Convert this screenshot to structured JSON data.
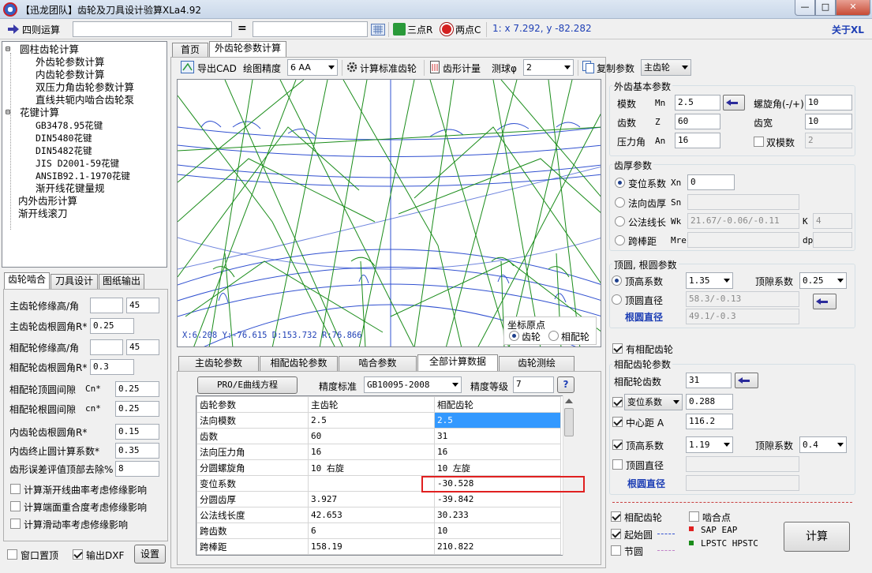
{
  "window": {
    "title": "【迅龙团队】齿轮及刀具设计验算XLa4.92",
    "min": "—",
    "max": "□",
    "close": "✕"
  },
  "calcbar": {
    "label": "四则运算",
    "equals": "=",
    "three_point": "三点R",
    "two_point": "两点C",
    "coords": "1: x 7.292, y -82.282",
    "about": "关于XL"
  },
  "tree": {
    "items": [
      {
        "label": "圆柱齿轮计算",
        "level": 0
      },
      {
        "label": "外齿轮参数计算",
        "level": 2
      },
      {
        "label": "内齿轮参数计算",
        "level": 2
      },
      {
        "label": "双压力角齿轮参数计算",
        "level": 2
      },
      {
        "label": "直线共轭内啮合齿轮泵",
        "level": 2
      },
      {
        "label": "花键计算",
        "level": 0
      },
      {
        "label": "GB3478.95花键",
        "level": 2
      },
      {
        "label": "DIN5480花键",
        "level": 2
      },
      {
        "label": "DIN5482花键",
        "level": 2
      },
      {
        "label": "JIS D2001-59花键",
        "level": 2
      },
      {
        "label": "ANSIB92.1-1970花键",
        "level": 2
      },
      {
        "label": "渐开线花键量规",
        "level": 2
      },
      {
        "label": "内外齿形计算",
        "level": 1
      },
      {
        "label": "渐开线滚刀",
        "level": 1
      }
    ]
  },
  "left_tabs": [
    "齿轮啮合",
    "刀具设计",
    "图纸输出"
  ],
  "mesh": {
    "fields": [
      {
        "label": "主齿轮修缘高/角",
        "v1": "",
        "v2": "45"
      },
      {
        "label": "主齿轮齿根圆角R*",
        "v1": "0.25"
      },
      {
        "label": "相配轮修缘高/角",
        "v1": "",
        "v2": "45"
      },
      {
        "label": "相配轮齿根圆角R*",
        "v1": "0.3"
      },
      {
        "label": "相配轮顶圆间隙",
        "sub": "Cn*",
        "v1": "0.25"
      },
      {
        "label": "相配轮根圆间隙",
        "sub": "cn*",
        "v1": "0.25"
      },
      {
        "label": "内齿轮齿根圆角R*",
        "v1": "0.15"
      },
      {
        "label": "内齿终止圆计算系数*",
        "v1": "0.35"
      },
      {
        "label": "齿形误差评值顶部去除%",
        "v1": "8"
      }
    ],
    "checks": [
      "计算渐开线曲率考虑修缘影响",
      "计算端面重合度考虑修缘影响",
      "计算滑动率考虑修缘影响"
    ],
    "bottom": {
      "topmost": "窗口置顶",
      "dxf": "输出DXF",
      "settings": "设置"
    }
  },
  "main_tabs": [
    "首页",
    "外齿轮参数计算"
  ],
  "toolbar": {
    "export": "导出CAD",
    "precision_label": "绘图精度",
    "precision": "6  AA",
    "calc_std": "计算标准齿轮",
    "tooth_measure": "齿形计量",
    "ball_label": "测球φ",
    "ball": "2",
    "copy": "复制参数",
    "gear_sel": "主齿轮"
  },
  "canvas": {
    "status": "X:6.208    Y:-76.615  D:153.732  R:76.866",
    "origin_title": "坐标原点",
    "origin_gear": "齿轮",
    "origin_mate": "相配轮"
  },
  "bottom_tabs": [
    "主齿轮参数",
    "相配齿轮参数",
    "啮合参数",
    "全部计算数据",
    "齿轮测绘"
  ],
  "data_panel": {
    "pro_btn": "PRO/E曲线方程",
    "std_label": "精度标准",
    "std": "GB10095-2008",
    "grade_label": "精度等级",
    "grade": "7",
    "help": "?"
  },
  "table": {
    "rows": [
      [
        "齿轮参数",
        "主齿轮",
        "相配齿轮"
      ],
      [
        "法向模数",
        "2.5",
        "2.5"
      ],
      [
        "齿数",
        "60",
        "31"
      ],
      [
        "法向压力角",
        "16",
        "16"
      ],
      [
        "分圆螺旋角",
        "10   右旋",
        "10   左旋"
      ],
      [
        "变位系数",
        "",
        "-30.528"
      ],
      [
        "分圆齿厚",
        "3.927",
        "-39.842"
      ],
      [
        "公法线长度",
        "42.653",
        "30.233"
      ],
      [
        "跨齿数",
        "6",
        "10"
      ],
      [
        "跨棒距",
        "158.19",
        "210.822"
      ]
    ]
  },
  "basic": {
    "title": "外齿基本参数",
    "module_label": "模数",
    "module_sub": "Mn",
    "module": "2.5",
    "helix_label": "螺旋角(-/+)",
    "helix": "10",
    "teeth_label": "齿数",
    "teeth_sub": "Z",
    "teeth": "60",
    "width_label": "齿宽",
    "width": "10",
    "pa_label": "压力角",
    "pa_sub": "An",
    "pa": "16",
    "double_label": "双模数",
    "double": "2"
  },
  "thick": {
    "title": "齿厚参数",
    "shift_label": "变位系数",
    "shift_sub": "Xn",
    "shift": "0",
    "normal_label": "法向齿厚",
    "normal_sub": "Sn",
    "normal": "",
    "wk_label": "公法线长",
    "wk_sub": "Wk",
    "wk": "21.67/-0.06/-0.11",
    "k_sub": "K",
    "k": "4",
    "mre_label": "跨棒距",
    "mre_sub": "Mre",
    "mre": "",
    "dp_sub": "dp",
    "dp": ""
  },
  "tip": {
    "title": "顶圆, 根圆参数",
    "addendum_label": "顶高系数",
    "addendum": "1.35",
    "clearance_label": "顶隙系数",
    "clearance": "0.25",
    "tipdia_label": "顶圆直径",
    "tipdia": "58.3/-0.13",
    "rootdia_label": "根圆直径",
    "rootdia": "49.1/-0.3"
  },
  "mate": {
    "has_label": "有相配齿轮",
    "title": "相配齿轮参数",
    "teeth_label": "相配轮齿数",
    "teeth": "31",
    "shift_sel": "变位系数",
    "shift": "0.288",
    "center_label": "中心距 A",
    "center": "116.2",
    "addendum_label": "顶高系数",
    "addendum": "1.19",
    "clearance_label": "顶隙系数",
    "clearance": "0.4",
    "tipdia_label": "顶圆直径",
    "tipdia": "",
    "rootdia_label": "根圆直径",
    "rootdia": ""
  },
  "legend": {
    "mate": "相配齿轮",
    "engage": "啮合点",
    "start": "起始圆",
    "pitch": "节圆",
    "sap": "SAP EAP",
    "lpstc": "LPSTC HPSTC",
    "calc": "计算"
  },
  "colors": {
    "gear": "#1a8c1a",
    "mate_gear": "#1f3fd0",
    "highlight": "#e02020",
    "selection": "#3399ff"
  }
}
